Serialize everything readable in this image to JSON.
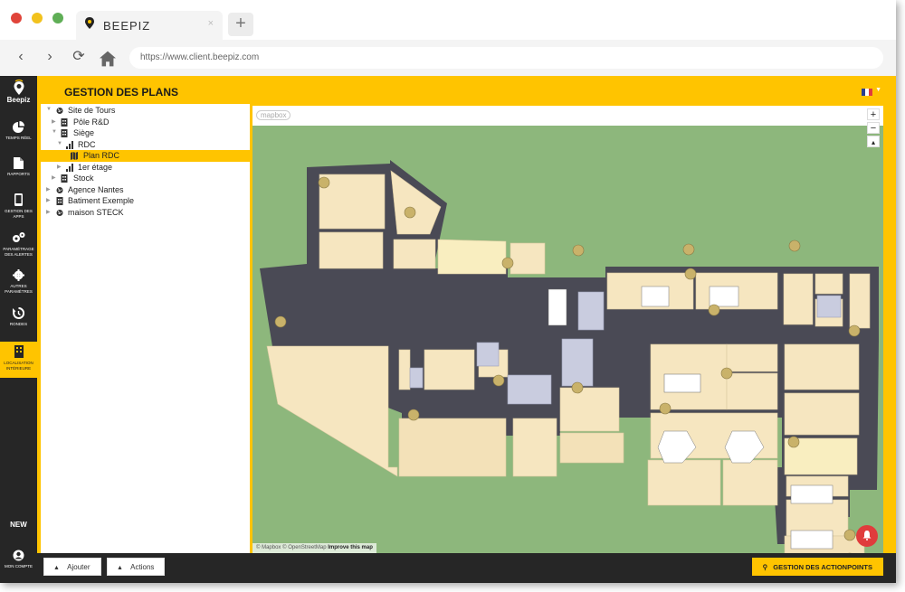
{
  "browser": {
    "tab_title": "BEEPIZ",
    "tab_close": "×",
    "new_tab": "+",
    "url": "https://www.client.beepiz.com",
    "traffic_colors": [
      "#e0443a",
      "#f2c21d",
      "#5fae56"
    ]
  },
  "app": {
    "brand": "Beepiz",
    "page_title": "GESTION DES PLANS",
    "accent_color": "#ffc400",
    "sidebar_color": "#262626",
    "language_flag": "fr-flag-icon"
  },
  "sidebar": {
    "items": [
      {
        "label": "TEMPS RÉEL",
        "icon": "pie-chart-icon"
      },
      {
        "label": "RAPPORTS",
        "icon": "document-icon"
      },
      {
        "label": "GESTION DES APPS",
        "icon": "phone-icon"
      },
      {
        "label": "PARAMÉTRAGE DES ALERTES",
        "icon": "gears-icon"
      },
      {
        "label": "AUTRES PARAMÈTRES",
        "icon": "gear-icon"
      },
      {
        "label": "RONDES",
        "icon": "history-icon"
      },
      {
        "label": "LOCALISATION INTÉRIEURE",
        "icon": "building-icon",
        "active": true
      }
    ],
    "new_label": "NEW",
    "account_label": "MON COMPTE"
  },
  "tree": [
    {
      "label": "Site de Tours",
      "icon": "globe-icon",
      "level": 0,
      "expanded": true
    },
    {
      "label": "Pôle R&D",
      "icon": "building-icon",
      "level": 1,
      "expanded": false
    },
    {
      "label": "Siège",
      "icon": "building-icon",
      "level": 1,
      "expanded": true
    },
    {
      "label": "RDC",
      "icon": "floor-icon",
      "level": 2,
      "expanded": true
    },
    {
      "label": "Plan RDC",
      "icon": "map-icon",
      "level": 3,
      "selected": true
    },
    {
      "label": "1er étage",
      "icon": "floor-icon",
      "level": 2,
      "expanded": false
    },
    {
      "label": "Stock",
      "icon": "building-icon",
      "level": 1,
      "expanded": false
    },
    {
      "label": "Agence Nantes",
      "icon": "globe-icon",
      "level": 0,
      "expanded": false
    },
    {
      "label": "Batiment Exemple",
      "icon": "building-icon",
      "level": 0,
      "expanded": false
    },
    {
      "label": "maison STECK",
      "icon": "globe-icon",
      "level": 0,
      "expanded": false
    }
  ],
  "map": {
    "logo": "mapbox",
    "zoom_in": "+",
    "zoom_out": "−",
    "attribution": "© Mapbox © OpenStreetMap",
    "improve": "Improve this map",
    "ground_color": "#8db77c",
    "room_color": "#f6e6c0",
    "wall_color": "#4a4a55"
  },
  "bottom": {
    "add_label": "Ajouter",
    "actions_label": "Actions",
    "gestion_label": "GESTION DES ACTIONPOINTS"
  }
}
